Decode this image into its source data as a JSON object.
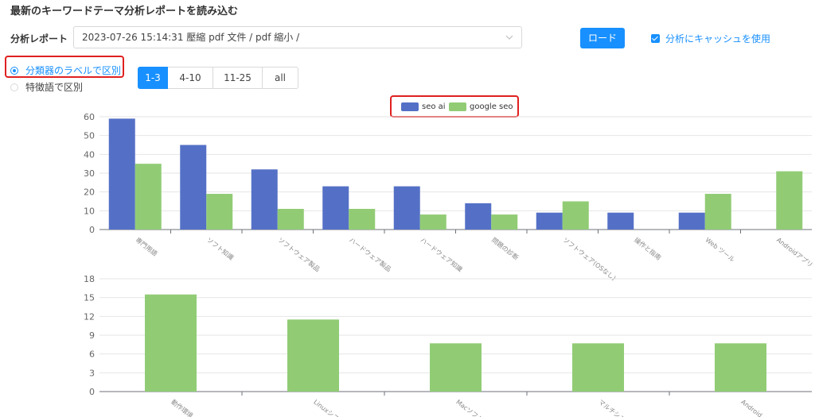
{
  "header": {
    "title": "最新のキーワードテーマ分析レポートを読み込む"
  },
  "report": {
    "label": "分析レポート",
    "selected": "2023-07-26 15:14:31 壓縮 pdf 文件 / pdf 縮小 /"
  },
  "load_label": "ロード",
  "cache": {
    "label": "分析にキャッシュを使用",
    "checked": true
  },
  "radios": [
    {
      "label": "分類器のラベルで区別",
      "checked": true
    },
    {
      "label": "特徴語で区別",
      "checked": false
    }
  ],
  "ranges": [
    {
      "label": "1-3",
      "active": true
    },
    {
      "label": "4-10",
      "active": false
    },
    {
      "label": "11-25",
      "active": false
    },
    {
      "label": "all",
      "active": false
    }
  ],
  "legend": [
    {
      "label": "seo ai",
      "color": "#5470c6"
    },
    {
      "label": "google seo",
      "color": "#91cc75"
    }
  ],
  "chart_data": [
    {
      "type": "bar",
      "categories": [
        "専門用語",
        "ソフト知識",
        "ソフトウェア製品",
        "ハードウェア製品",
        "ハードウェア知識",
        "問題の診断",
        "ソフトウェア(OSなし)",
        "操作と指南",
        "Web ツール",
        "Androidアプリ"
      ],
      "series": [
        {
          "name": "seo ai",
          "color": "#5470c6",
          "values": [
            59,
            45,
            32,
            23,
            23,
            14,
            9,
            9,
            9,
            0
          ]
        },
        {
          "name": "google seo",
          "color": "#91cc75",
          "values": [
            35,
            19,
            11,
            11,
            8,
            8,
            15,
            0,
            19,
            31
          ]
        }
      ],
      "yticks": [
        0,
        10,
        20,
        30,
        40,
        50,
        60
      ],
      "ylim": [
        0,
        60
      ],
      "grid": true,
      "legend": "top"
    },
    {
      "type": "bar",
      "categories": [
        "動作環境",
        "Linuxシス",
        "Macソフト",
        "マルチシス",
        "Android"
      ],
      "series": [
        {
          "name": "google seo",
          "color": "#91cc75",
          "values": [
            15.5,
            11.5,
            7.7,
            7.7,
            7.7
          ]
        }
      ],
      "yticks": [
        0,
        3,
        6,
        9,
        12,
        15,
        18
      ],
      "ylim": [
        0,
        18
      ],
      "grid": true
    }
  ]
}
